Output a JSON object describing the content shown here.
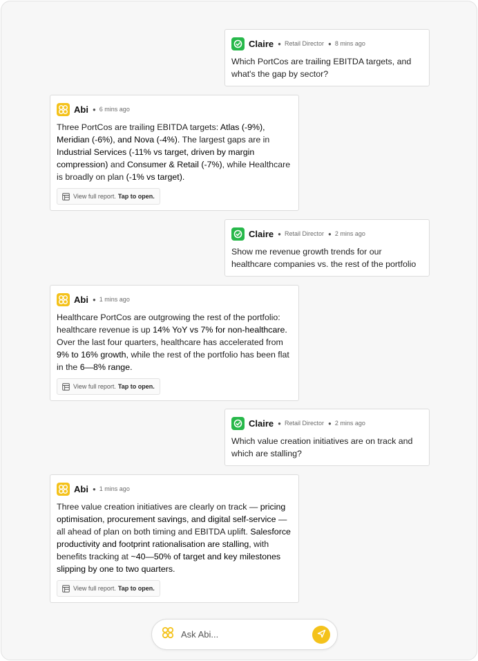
{
  "messages": [
    {
      "sender": "Claire",
      "role": "Retail Director",
      "time": "8 mins ago",
      "text": "Which PortCos are trailing EBITDA targets, and what's the gap by sector?"
    },
    {
      "sender": "Abi",
      "time": "6 mins ago",
      "segments": [
        {
          "t": "Three PortCos are trailing EBITDA targets: ",
          "b": false
        },
        {
          "t": "Atlas (-9%), Meridian (-6%), and Nova (-4%).",
          "b": true
        },
        {
          "t": " The largest gaps are in ",
          "b": false
        },
        {
          "t": "Industrial Services (-11% vs target, driven by margin compression)",
          "b": true
        },
        {
          "t": " and ",
          "b": false
        },
        {
          "t": "Consumer & Retail (-7%)",
          "b": true
        },
        {
          "t": ", while Healthcare is broadly on plan ",
          "b": false
        },
        {
          "t": "(-1% vs target).",
          "b": true
        }
      ],
      "report_label": "View full report.",
      "report_tap": "Tap to open."
    },
    {
      "sender": "Claire",
      "role": "Retail Director",
      "time": "2 mins ago",
      "text": "Show me revenue growth trends for our healthcare companies vs. the rest of the portfolio"
    },
    {
      "sender": "Abi",
      "time": "1 mins ago",
      "segments": [
        {
          "t": "Healthcare PortCos are outgrowing the rest of the portfolio: healthcare revenue is up ",
          "b": false
        },
        {
          "t": "14% YoY vs 7% for non-healthcare.",
          "b": true
        },
        {
          "t": " Over the last four quarters, healthcare has accelerated from ",
          "b": false
        },
        {
          "t": "9% to 16% growth,",
          "b": true
        },
        {
          "t": " while the rest of the portfolio has been flat in the ",
          "b": false
        },
        {
          "t": "6—8% range.",
          "b": true
        }
      ],
      "report_label": "View full report.",
      "report_tap": "Tap to open."
    },
    {
      "sender": "Claire",
      "role": "Retail Director",
      "time": "2 mins ago",
      "text": "Which value creation initiatives are on track and which are stalling?"
    },
    {
      "sender": "Abi",
      "time": "1 mins ago",
      "segments": [
        {
          "t": "Three value creation initiatives are clearly on track — ",
          "b": false
        },
        {
          "t": "pricing optimisation, procurement savings, and digital self-service",
          "b": true
        },
        {
          "t": " — all ahead of plan on both timing and EBITDA uplift. ",
          "b": false
        },
        {
          "t": "Salesforce productivity and footprint rationalisation are stalling,",
          "b": true
        },
        {
          "t": " with benefits tracking at ",
          "b": false
        },
        {
          "t": "~40—50% of target and key milestones slipping by one to two quarters.",
          "b": true
        }
      ],
      "report_label": "View full report.",
      "report_tap": "Tap to open."
    }
  ],
  "composer": {
    "placeholder": "Ask Abi...",
    "send_icon": "send-icon"
  },
  "colors": {
    "claire_avatar": "#27b84a",
    "abi_avatar": "#f4c21b",
    "send_button": "#f4c21b"
  }
}
